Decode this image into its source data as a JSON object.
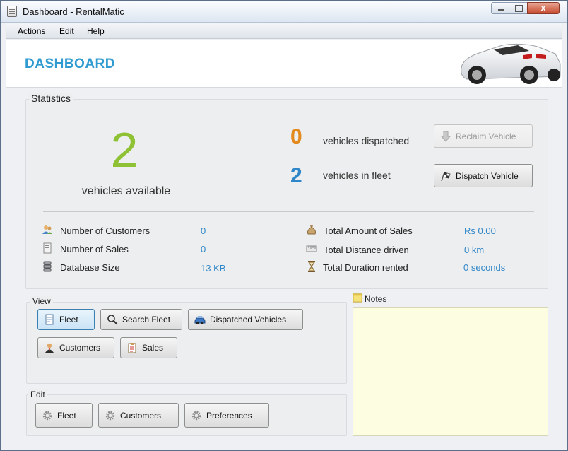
{
  "window": {
    "title": "Dashboard - RentalMatic",
    "close_glyph": "x"
  },
  "menu": [
    "Actions",
    "Edit",
    "Help"
  ],
  "header": {
    "title": "DASHBOARD"
  },
  "statistics": {
    "title": "Statistics",
    "vehicles_available": "2",
    "vehicles_available_label": "vehicles available",
    "dispatched_count": "0",
    "dispatched_label": "vehicles dispatched",
    "fleet_count": "2",
    "fleet_label": "vehicles in fleet",
    "reclaim_button": "Reclaim Vehicle",
    "dispatch_button": "Dispatch Vehicle",
    "colors": {
      "available": "#8ec234",
      "dispatched": "#e38a1f",
      "fleet": "#2f86c8",
      "value": "#2f86c8"
    },
    "left_stats": [
      {
        "label": "Number of Customers",
        "value": "0",
        "icon": "customers-icon"
      },
      {
        "label": "Number of Sales",
        "value": "0",
        "icon": "sales-icon"
      },
      {
        "label": "Database Size",
        "value": "13 KB",
        "icon": "database-icon"
      }
    ],
    "right_stats": [
      {
        "label": "Total Amount of Sales",
        "value": "Rs 0.00",
        "icon": "money-bag-icon"
      },
      {
        "label": "Total Distance driven",
        "value": "0 km",
        "icon": "distance-icon"
      },
      {
        "label": "Total Duration rented",
        "value": "0 seconds",
        "icon": "hourglass-icon"
      }
    ]
  },
  "view": {
    "title": "View",
    "buttons": {
      "fleet": "Fleet",
      "search_fleet": "Search Fleet",
      "dispatched": "Dispatched Vehicles",
      "customers": "Customers",
      "sales": "Sales"
    }
  },
  "edit": {
    "title": "Edit",
    "buttons": {
      "fleet": "Fleet",
      "customers": "Customers",
      "preferences": "Preferences"
    }
  },
  "notes": {
    "title": "Notes"
  }
}
